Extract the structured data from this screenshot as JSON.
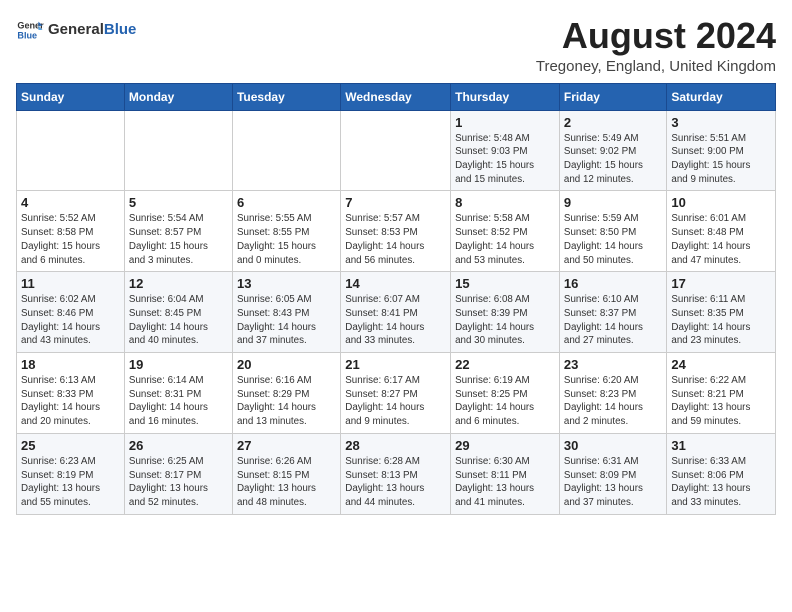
{
  "header": {
    "logo_general": "General",
    "logo_blue": "Blue",
    "title": "August 2024",
    "subtitle": "Tregoney, England, United Kingdom"
  },
  "weekdays": [
    "Sunday",
    "Monday",
    "Tuesday",
    "Wednesday",
    "Thursday",
    "Friday",
    "Saturday"
  ],
  "weeks": [
    [
      {
        "day": "",
        "info": ""
      },
      {
        "day": "",
        "info": ""
      },
      {
        "day": "",
        "info": ""
      },
      {
        "day": "",
        "info": ""
      },
      {
        "day": "1",
        "info": "Sunrise: 5:48 AM\nSunset: 9:03 PM\nDaylight: 15 hours\nand 15 minutes."
      },
      {
        "day": "2",
        "info": "Sunrise: 5:49 AM\nSunset: 9:02 PM\nDaylight: 15 hours\nand 12 minutes."
      },
      {
        "day": "3",
        "info": "Sunrise: 5:51 AM\nSunset: 9:00 PM\nDaylight: 15 hours\nand 9 minutes."
      }
    ],
    [
      {
        "day": "4",
        "info": "Sunrise: 5:52 AM\nSunset: 8:58 PM\nDaylight: 15 hours\nand 6 minutes."
      },
      {
        "day": "5",
        "info": "Sunrise: 5:54 AM\nSunset: 8:57 PM\nDaylight: 15 hours\nand 3 minutes."
      },
      {
        "day": "6",
        "info": "Sunrise: 5:55 AM\nSunset: 8:55 PM\nDaylight: 15 hours\nand 0 minutes."
      },
      {
        "day": "7",
        "info": "Sunrise: 5:57 AM\nSunset: 8:53 PM\nDaylight: 14 hours\nand 56 minutes."
      },
      {
        "day": "8",
        "info": "Sunrise: 5:58 AM\nSunset: 8:52 PM\nDaylight: 14 hours\nand 53 minutes."
      },
      {
        "day": "9",
        "info": "Sunrise: 5:59 AM\nSunset: 8:50 PM\nDaylight: 14 hours\nand 50 minutes."
      },
      {
        "day": "10",
        "info": "Sunrise: 6:01 AM\nSunset: 8:48 PM\nDaylight: 14 hours\nand 47 minutes."
      }
    ],
    [
      {
        "day": "11",
        "info": "Sunrise: 6:02 AM\nSunset: 8:46 PM\nDaylight: 14 hours\nand 43 minutes."
      },
      {
        "day": "12",
        "info": "Sunrise: 6:04 AM\nSunset: 8:45 PM\nDaylight: 14 hours\nand 40 minutes."
      },
      {
        "day": "13",
        "info": "Sunrise: 6:05 AM\nSunset: 8:43 PM\nDaylight: 14 hours\nand 37 minutes."
      },
      {
        "day": "14",
        "info": "Sunrise: 6:07 AM\nSunset: 8:41 PM\nDaylight: 14 hours\nand 33 minutes."
      },
      {
        "day": "15",
        "info": "Sunrise: 6:08 AM\nSunset: 8:39 PM\nDaylight: 14 hours\nand 30 minutes."
      },
      {
        "day": "16",
        "info": "Sunrise: 6:10 AM\nSunset: 8:37 PM\nDaylight: 14 hours\nand 27 minutes."
      },
      {
        "day": "17",
        "info": "Sunrise: 6:11 AM\nSunset: 8:35 PM\nDaylight: 14 hours\nand 23 minutes."
      }
    ],
    [
      {
        "day": "18",
        "info": "Sunrise: 6:13 AM\nSunset: 8:33 PM\nDaylight: 14 hours\nand 20 minutes."
      },
      {
        "day": "19",
        "info": "Sunrise: 6:14 AM\nSunset: 8:31 PM\nDaylight: 14 hours\nand 16 minutes."
      },
      {
        "day": "20",
        "info": "Sunrise: 6:16 AM\nSunset: 8:29 PM\nDaylight: 14 hours\nand 13 minutes."
      },
      {
        "day": "21",
        "info": "Sunrise: 6:17 AM\nSunset: 8:27 PM\nDaylight: 14 hours\nand 9 minutes."
      },
      {
        "day": "22",
        "info": "Sunrise: 6:19 AM\nSunset: 8:25 PM\nDaylight: 14 hours\nand 6 minutes."
      },
      {
        "day": "23",
        "info": "Sunrise: 6:20 AM\nSunset: 8:23 PM\nDaylight: 14 hours\nand 2 minutes."
      },
      {
        "day": "24",
        "info": "Sunrise: 6:22 AM\nSunset: 8:21 PM\nDaylight: 13 hours\nand 59 minutes."
      }
    ],
    [
      {
        "day": "25",
        "info": "Sunrise: 6:23 AM\nSunset: 8:19 PM\nDaylight: 13 hours\nand 55 minutes."
      },
      {
        "day": "26",
        "info": "Sunrise: 6:25 AM\nSunset: 8:17 PM\nDaylight: 13 hours\nand 52 minutes."
      },
      {
        "day": "27",
        "info": "Sunrise: 6:26 AM\nSunset: 8:15 PM\nDaylight: 13 hours\nand 48 minutes."
      },
      {
        "day": "28",
        "info": "Sunrise: 6:28 AM\nSunset: 8:13 PM\nDaylight: 13 hours\nand 44 minutes."
      },
      {
        "day": "29",
        "info": "Sunrise: 6:30 AM\nSunset: 8:11 PM\nDaylight: 13 hours\nand 41 minutes."
      },
      {
        "day": "30",
        "info": "Sunrise: 6:31 AM\nSunset: 8:09 PM\nDaylight: 13 hours\nand 37 minutes."
      },
      {
        "day": "31",
        "info": "Sunrise: 6:33 AM\nSunset: 8:06 PM\nDaylight: 13 hours\nand 33 minutes."
      }
    ]
  ]
}
